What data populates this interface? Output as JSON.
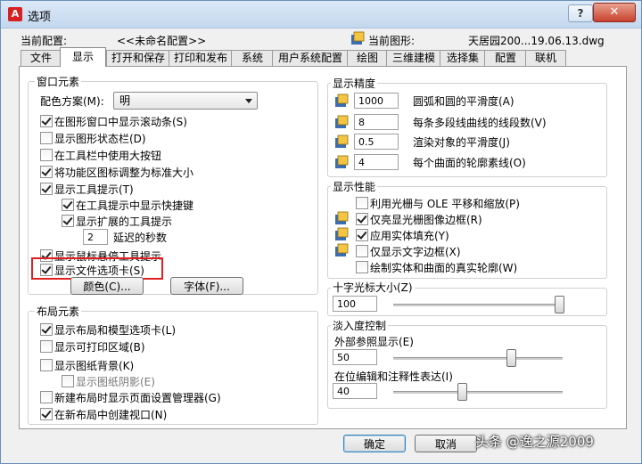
{
  "window": {
    "title": "选项",
    "help": "?",
    "close": "✕"
  },
  "profile": {
    "label": "当前配置:",
    "value": "<<未命名配置>>"
  },
  "drawing": {
    "label": "当前图形:",
    "value": "天居园200...19.06.13.dwg"
  },
  "tabs": [
    "文件",
    "显示",
    "打开和保存",
    "打印和发布",
    "系统",
    "用户系统配置",
    "绘图",
    "三维建模",
    "选择集",
    "配置",
    "联机"
  ],
  "window_elements": {
    "title": "窗口元素",
    "color_scheme_label": "配色方案(M):",
    "color_scheme_value": "明",
    "items": [
      {
        "label": "在图形窗口中显示滚动条(S)",
        "checked": true
      },
      {
        "label": "显示图形状态栏(D)",
        "checked": false
      },
      {
        "label": "在工具栏中使用大按钮",
        "checked": false
      },
      {
        "label": "将功能区图标调整为标准大小",
        "checked": true
      },
      {
        "label": "显示工具提示(T)",
        "checked": true
      },
      {
        "label": "在工具提示中显示快捷键",
        "checked": true
      },
      {
        "label": "显示扩展的工具提示",
        "checked": true
      },
      {
        "label": "显示鼠标悬停工具提示",
        "checked": true
      },
      {
        "label": "显示文件选项卡(S)",
        "checked": true
      }
    ],
    "delay_value": "2",
    "delay_label": "延迟的秒数",
    "color_button": "颜色(C)...",
    "font_button": "字体(F)..."
  },
  "layout_elements": {
    "title": "布局元素",
    "items": [
      {
        "label": "显示布局和模型选项卡(L)",
        "checked": true
      },
      {
        "label": "显示可打印区域(B)",
        "checked": false
      },
      {
        "label": "显示图纸背景(K)",
        "checked": false
      },
      {
        "label": "显示图纸阴影(E)",
        "checked": false
      },
      {
        "label": "新建布局时显示页面设置管理器(G)",
        "checked": false
      },
      {
        "label": "在新布局中创建视口(N)",
        "checked": true
      }
    ]
  },
  "display_resolution": {
    "title": "显示精度",
    "items": [
      {
        "value": "1000",
        "label": "圆弧和圆的平滑度(A)"
      },
      {
        "value": "8",
        "label": "每条多段线曲线的线段数(V)"
      },
      {
        "value": "0.5",
        "label": "渲染对象的平滑度(J)"
      },
      {
        "value": "4",
        "label": "每个曲面的轮廓素线(O)"
      }
    ]
  },
  "display_performance": {
    "title": "显示性能",
    "items": [
      {
        "label": "利用光栅与 OLE 平移和缩放(P)",
        "checked": false
      },
      {
        "label": "仅亮显光栅图像边框(R)",
        "checked": true
      },
      {
        "label": "应用实体填充(Y)",
        "checked": true
      },
      {
        "label": "仅显示文字边框(X)",
        "checked": false
      },
      {
        "label": "绘制实体和曲面的真实轮廓(W)",
        "checked": false
      }
    ]
  },
  "crosshair": {
    "title": "十字光标大小(Z)",
    "value": "100",
    "fraction": 1.0
  },
  "fade": {
    "title": "淡入度控制",
    "xref_label": "外部参照显示(E)",
    "xref_value": "50",
    "xref_fraction": 0.7,
    "inplace_label": "在位编辑和注释性表达(I)",
    "inplace_value": "40",
    "inplace_fraction": 0.4
  },
  "buttons": {
    "ok": "确定",
    "cancel": "取消"
  },
  "watermark": "头条 @逸之源2009"
}
